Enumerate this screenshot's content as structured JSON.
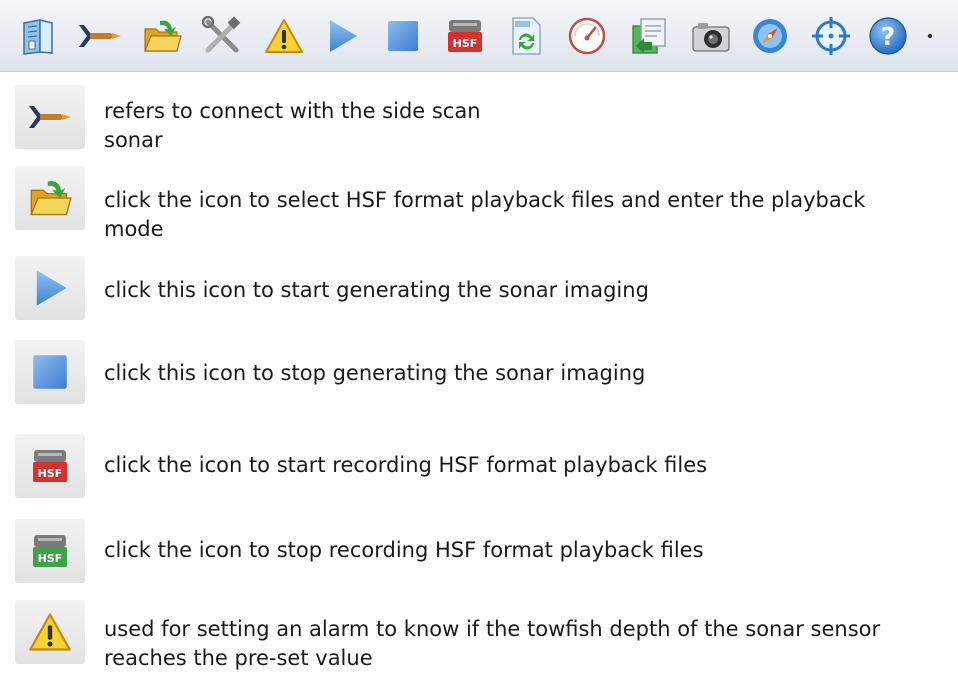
{
  "toolbar": {
    "buttons": [
      {
        "icon": "book-icon"
      },
      {
        "icon": "towfish-icon"
      },
      {
        "icon": "open-folder-icon"
      },
      {
        "icon": "tools-icon"
      },
      {
        "icon": "warning-icon"
      },
      {
        "icon": "play-icon"
      },
      {
        "icon": "stop-icon"
      },
      {
        "icon": "hsf-record-icon",
        "label": "HSF"
      },
      {
        "icon": "hsf-convert-icon"
      },
      {
        "icon": "gauge-icon"
      },
      {
        "icon": "export-icon"
      },
      {
        "icon": "camera-icon"
      },
      {
        "icon": "compass-icon"
      },
      {
        "icon": "crosshair-icon"
      },
      {
        "icon": "help-icon",
        "label": "?"
      }
    ],
    "overflow_icon": "dropdown-arrow-icon",
    "colors": {
      "background_top": "#f4f6fa",
      "background_bottom": "#dfe4ec"
    }
  },
  "legend": {
    "items": [
      {
        "icon": "towfish-icon",
        "lines": [
          "refers to connect with the side scan",
          "sonar"
        ]
      },
      {
        "icon": "open-folder-icon",
        "lines": [
          "click the icon to select HSF format playback files and enter the playback",
          "mode"
        ]
      },
      {
        "icon": "play-icon",
        "lines": [
          "click this icon to start generating the sonar imaging"
        ]
      },
      {
        "icon": "stop-icon",
        "lines": [
          "click this icon to stop generating the sonar imaging"
        ]
      },
      {
        "icon": "hsf-record-start-icon",
        "badge": "HSF",
        "lines": [
          "click the icon to start recording HSF format playback files"
        ]
      },
      {
        "icon": "hsf-record-stop-icon",
        "badge": "HSF",
        "lines": [
          "click the icon to stop recording HSF format playback files"
        ]
      },
      {
        "icon": "warning-icon",
        "lines": [
          "used for setting an alarm to know if the towfish depth of the sonar sensor",
          "reaches the pre-set value"
        ]
      }
    ]
  }
}
